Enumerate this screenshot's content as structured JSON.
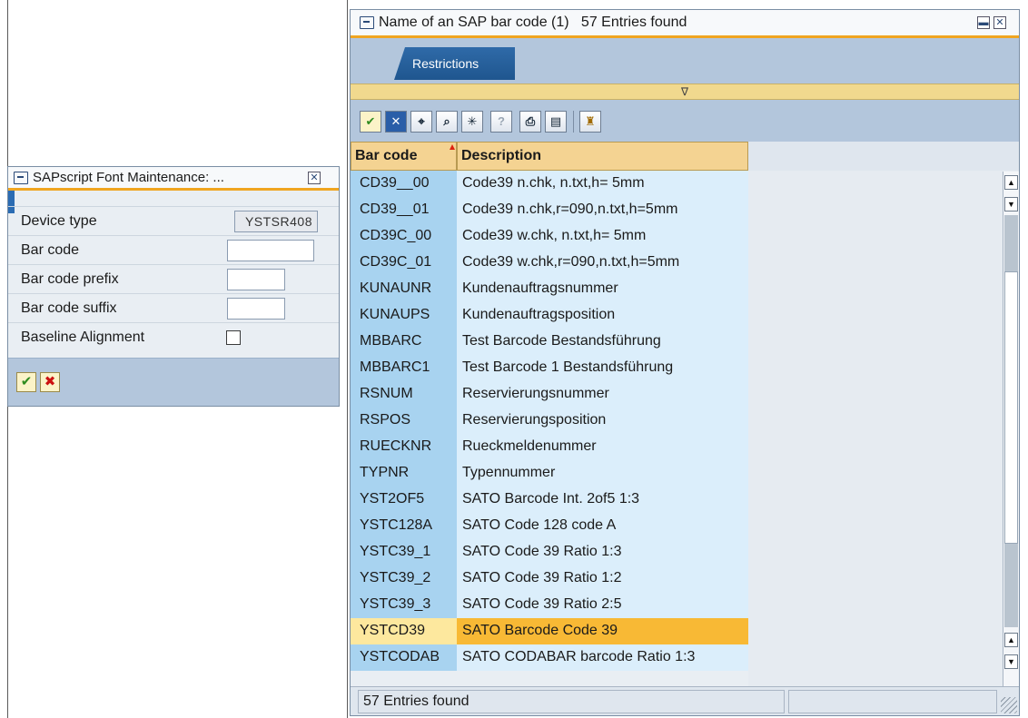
{
  "small_dialog": {
    "title": "SAPscript Font Maintenance: ...",
    "fields": {
      "device_type_label": "Device type",
      "device_type_value": "YSTSR408",
      "bar_code_label": "Bar code",
      "bar_code_value": "",
      "prefix_label": "Bar code prefix",
      "prefix_value": "",
      "suffix_label": "Bar code suffix",
      "suffix_value": "",
      "baseline_label": "Baseline Alignment",
      "baseline_checked": false
    },
    "icons": {
      "ok": "checkmark-icon",
      "cancel": "cancel-x-icon",
      "close": "close-icon"
    }
  },
  "big_dialog": {
    "title": "Name of an SAP bar code (1)   57 Entries found",
    "tab_label": "Restrictions",
    "splitter_glyph": "∇",
    "toolbar_icons": [
      "checkmark-icon",
      "cancel-icon",
      "find-icon",
      "find-next-icon",
      "new-list-icon",
      "help-icon",
      "print-icon",
      "local-file-icon",
      "personal-list-icon"
    ],
    "columns": [
      "Bar code",
      "Description"
    ],
    "rows": [
      {
        "code": "CD39__00",
        "desc": "Code39 n.chk,     n.txt,h= 5mm"
      },
      {
        "code": "CD39__01",
        "desc": "Code39 n.chk,r=090,n.txt,h=5mm"
      },
      {
        "code": "CD39C_00",
        "desc": "Code39 w.chk,     n.txt,h= 5mm"
      },
      {
        "code": "CD39C_01",
        "desc": "Code39 w.chk,r=090,n.txt,h=5mm"
      },
      {
        "code": "KUNAUNR",
        "desc": "Kundenauftragsnummer"
      },
      {
        "code": "KUNAUPS",
        "desc": "Kundenauftragsposition"
      },
      {
        "code": "MBBARC",
        "desc": "Test Barcode Bestandsführung"
      },
      {
        "code": "MBBARC1",
        "desc": "Test Barcode 1 Bestandsführung"
      },
      {
        "code": "RSNUM",
        "desc": "Reservierungsnummer"
      },
      {
        "code": "RSPOS",
        "desc": "Reservierungsposition"
      },
      {
        "code": "RUECKNR",
        "desc": "Rueckmeldenummer"
      },
      {
        "code": "TYPNR",
        "desc": "Typennummer"
      },
      {
        "code": "YST2OF5",
        "desc": "SATO Barcode Int. 2of5 1:3"
      },
      {
        "code": "YSTC128A",
        "desc": "SATO Code 128 code A"
      },
      {
        "code": "YSTC39_1",
        "desc": "SATO Code 39 Ratio 1:3"
      },
      {
        "code": "YSTC39_2",
        "desc": "SATO Code 39 Ratio 1:2"
      },
      {
        "code": "YSTC39_3",
        "desc": "SATO Code 39 Ratio 2:5"
      },
      {
        "code": "YSTCD39",
        "desc": "SATO Barcode Code 39",
        "selected": true
      },
      {
        "code": "YSTCODAB",
        "desc": "SATO CODABAR barcode Ratio 1:3"
      }
    ],
    "status_text": "57 Entries found"
  }
}
